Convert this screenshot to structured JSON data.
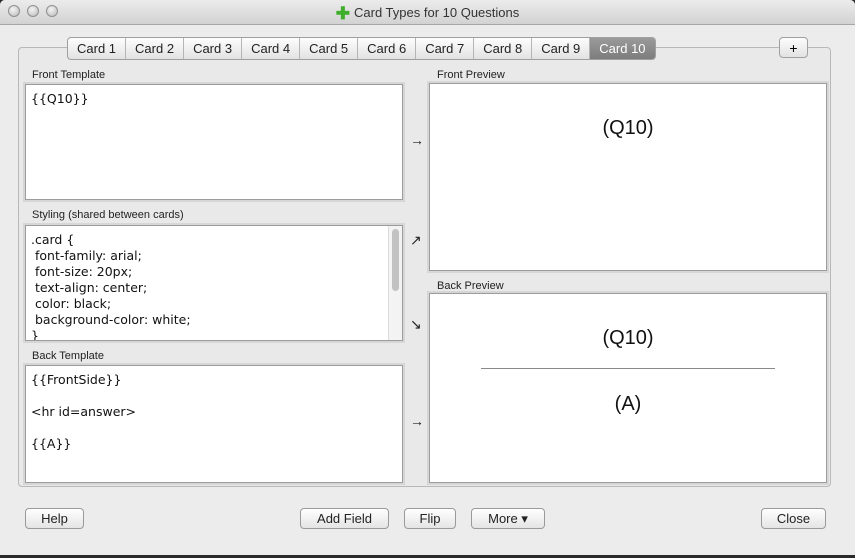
{
  "window": {
    "title": "Card Types for 10 Questions"
  },
  "tabs": [
    "Card 1",
    "Card 2",
    "Card 3",
    "Card 4",
    "Card 5",
    "Card 6",
    "Card 7",
    "Card 8",
    "Card 9",
    "Card 10"
  ],
  "active_tab": "Card 10",
  "add_tab_label": "+",
  "front_template": {
    "label": "Front Template",
    "content": "{{Q10}}"
  },
  "styling": {
    "label": "Styling (shared between cards)",
    "content": ".card {\n font-family: arial;\n font-size: 20px;\n text-align: center;\n color: black;\n background-color: white;\n}"
  },
  "back_template": {
    "label": "Back Template",
    "content": "{{FrontSide}}\n\n<hr id=answer>\n\n{{A}}"
  },
  "front_preview": {
    "label": "Front Preview",
    "question": "(Q10)"
  },
  "back_preview": {
    "label": "Back Preview",
    "question": "(Q10)",
    "answer": "(A)"
  },
  "arrows": {
    "front": "→",
    "styling_up": "↗",
    "styling_down": "↘",
    "back": "→"
  },
  "buttons": {
    "help": "Help",
    "add_field": "Add Field",
    "flip": "Flip",
    "more": "More ▾",
    "close": "Close"
  }
}
